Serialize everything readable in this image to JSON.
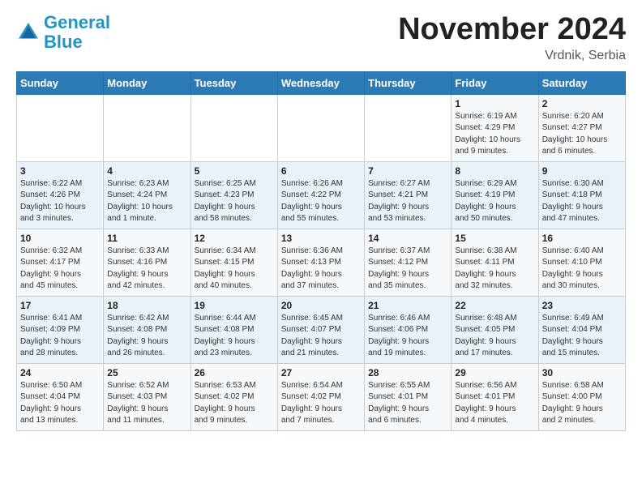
{
  "header": {
    "logo_line1": "General",
    "logo_line2": "Blue",
    "month": "November 2024",
    "location": "Vrdnik, Serbia"
  },
  "weekdays": [
    "Sunday",
    "Monday",
    "Tuesday",
    "Wednesday",
    "Thursday",
    "Friday",
    "Saturday"
  ],
  "weeks": [
    [
      {
        "day": "",
        "info": ""
      },
      {
        "day": "",
        "info": ""
      },
      {
        "day": "",
        "info": ""
      },
      {
        "day": "",
        "info": ""
      },
      {
        "day": "",
        "info": ""
      },
      {
        "day": "1",
        "info": "Sunrise: 6:19 AM\nSunset: 4:29 PM\nDaylight: 10 hours\nand 9 minutes."
      },
      {
        "day": "2",
        "info": "Sunrise: 6:20 AM\nSunset: 4:27 PM\nDaylight: 10 hours\nand 6 minutes."
      }
    ],
    [
      {
        "day": "3",
        "info": "Sunrise: 6:22 AM\nSunset: 4:26 PM\nDaylight: 10 hours\nand 3 minutes."
      },
      {
        "day": "4",
        "info": "Sunrise: 6:23 AM\nSunset: 4:24 PM\nDaylight: 10 hours\nand 1 minute."
      },
      {
        "day": "5",
        "info": "Sunrise: 6:25 AM\nSunset: 4:23 PM\nDaylight: 9 hours\nand 58 minutes."
      },
      {
        "day": "6",
        "info": "Sunrise: 6:26 AM\nSunset: 4:22 PM\nDaylight: 9 hours\nand 55 minutes."
      },
      {
        "day": "7",
        "info": "Sunrise: 6:27 AM\nSunset: 4:21 PM\nDaylight: 9 hours\nand 53 minutes."
      },
      {
        "day": "8",
        "info": "Sunrise: 6:29 AM\nSunset: 4:19 PM\nDaylight: 9 hours\nand 50 minutes."
      },
      {
        "day": "9",
        "info": "Sunrise: 6:30 AM\nSunset: 4:18 PM\nDaylight: 9 hours\nand 47 minutes."
      }
    ],
    [
      {
        "day": "10",
        "info": "Sunrise: 6:32 AM\nSunset: 4:17 PM\nDaylight: 9 hours\nand 45 minutes."
      },
      {
        "day": "11",
        "info": "Sunrise: 6:33 AM\nSunset: 4:16 PM\nDaylight: 9 hours\nand 42 minutes."
      },
      {
        "day": "12",
        "info": "Sunrise: 6:34 AM\nSunset: 4:15 PM\nDaylight: 9 hours\nand 40 minutes."
      },
      {
        "day": "13",
        "info": "Sunrise: 6:36 AM\nSunset: 4:13 PM\nDaylight: 9 hours\nand 37 minutes."
      },
      {
        "day": "14",
        "info": "Sunrise: 6:37 AM\nSunset: 4:12 PM\nDaylight: 9 hours\nand 35 minutes."
      },
      {
        "day": "15",
        "info": "Sunrise: 6:38 AM\nSunset: 4:11 PM\nDaylight: 9 hours\nand 32 minutes."
      },
      {
        "day": "16",
        "info": "Sunrise: 6:40 AM\nSunset: 4:10 PM\nDaylight: 9 hours\nand 30 minutes."
      }
    ],
    [
      {
        "day": "17",
        "info": "Sunrise: 6:41 AM\nSunset: 4:09 PM\nDaylight: 9 hours\nand 28 minutes."
      },
      {
        "day": "18",
        "info": "Sunrise: 6:42 AM\nSunset: 4:08 PM\nDaylight: 9 hours\nand 26 minutes."
      },
      {
        "day": "19",
        "info": "Sunrise: 6:44 AM\nSunset: 4:08 PM\nDaylight: 9 hours\nand 23 minutes."
      },
      {
        "day": "20",
        "info": "Sunrise: 6:45 AM\nSunset: 4:07 PM\nDaylight: 9 hours\nand 21 minutes."
      },
      {
        "day": "21",
        "info": "Sunrise: 6:46 AM\nSunset: 4:06 PM\nDaylight: 9 hours\nand 19 minutes."
      },
      {
        "day": "22",
        "info": "Sunrise: 6:48 AM\nSunset: 4:05 PM\nDaylight: 9 hours\nand 17 minutes."
      },
      {
        "day": "23",
        "info": "Sunrise: 6:49 AM\nSunset: 4:04 PM\nDaylight: 9 hours\nand 15 minutes."
      }
    ],
    [
      {
        "day": "24",
        "info": "Sunrise: 6:50 AM\nSunset: 4:04 PM\nDaylight: 9 hours\nand 13 minutes."
      },
      {
        "day": "25",
        "info": "Sunrise: 6:52 AM\nSunset: 4:03 PM\nDaylight: 9 hours\nand 11 minutes."
      },
      {
        "day": "26",
        "info": "Sunrise: 6:53 AM\nSunset: 4:02 PM\nDaylight: 9 hours\nand 9 minutes."
      },
      {
        "day": "27",
        "info": "Sunrise: 6:54 AM\nSunset: 4:02 PM\nDaylight: 9 hours\nand 7 minutes."
      },
      {
        "day": "28",
        "info": "Sunrise: 6:55 AM\nSunset: 4:01 PM\nDaylight: 9 hours\nand 6 minutes."
      },
      {
        "day": "29",
        "info": "Sunrise: 6:56 AM\nSunset: 4:01 PM\nDaylight: 9 hours\nand 4 minutes."
      },
      {
        "day": "30",
        "info": "Sunrise: 6:58 AM\nSunset: 4:00 PM\nDaylight: 9 hours\nand 2 minutes."
      }
    ]
  ]
}
